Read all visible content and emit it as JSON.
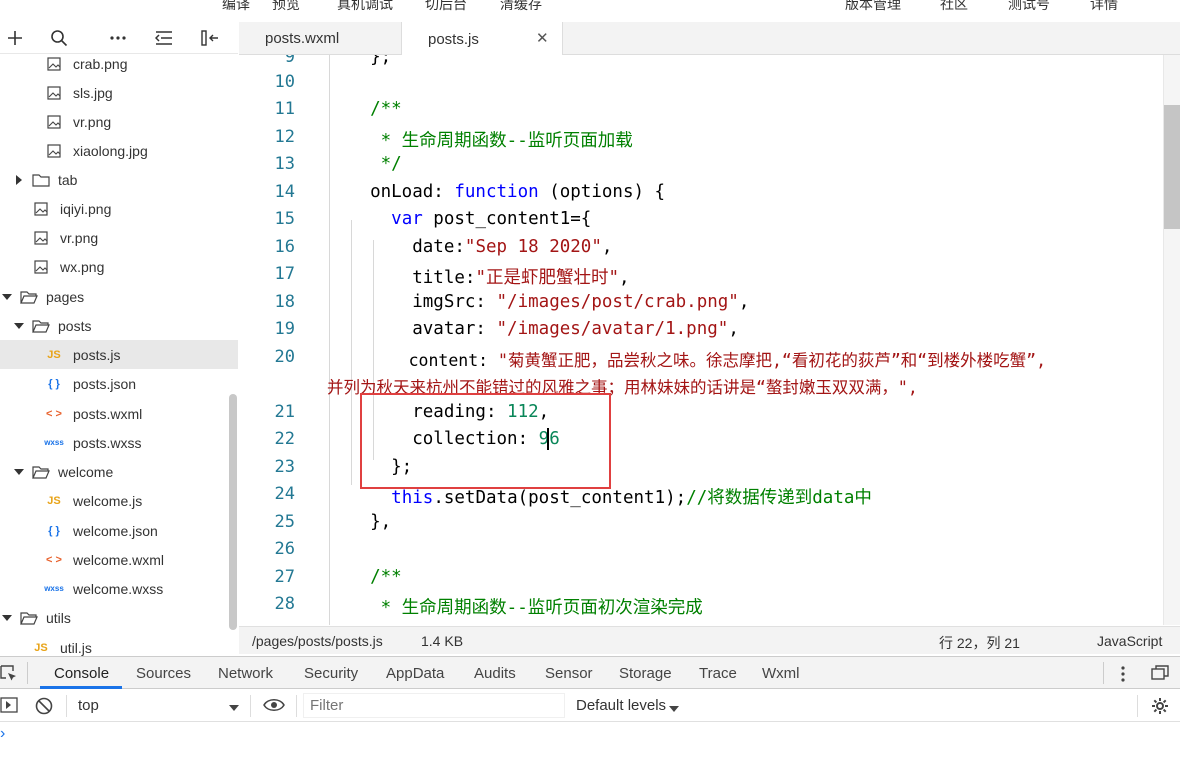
{
  "menu": [
    "编译",
    "预览",
    "真机调试",
    "切后台",
    "清缓存",
    "版本管理",
    "社区",
    "测试号",
    "详情"
  ],
  "explorer": {
    "items": [
      {
        "label": "crab.png",
        "type": "image"
      },
      {
        "label": "sls.jpg",
        "type": "image"
      },
      {
        "label": "vr.png",
        "type": "image"
      },
      {
        "label": "xiaolong.jpg",
        "type": "image"
      },
      {
        "label": "tab",
        "type": "folder",
        "expanded": false
      },
      {
        "label": "iqiyi.png",
        "type": "image"
      },
      {
        "label": "vr.png",
        "type": "image"
      },
      {
        "label": "wx.png",
        "type": "image"
      },
      {
        "label": "pages",
        "type": "folder",
        "expanded": true
      },
      {
        "label": "posts",
        "type": "folder",
        "expanded": true
      },
      {
        "label": "posts.js",
        "type": "js",
        "selected": true
      },
      {
        "label": "posts.json",
        "type": "json"
      },
      {
        "label": "posts.wxml",
        "type": "wxml"
      },
      {
        "label": "posts.wxss",
        "type": "wxss"
      },
      {
        "label": "welcome",
        "type": "folder",
        "expanded": true
      },
      {
        "label": "welcome.js",
        "type": "js"
      },
      {
        "label": "welcome.json",
        "type": "json"
      },
      {
        "label": "welcome.wxml",
        "type": "wxml"
      },
      {
        "label": "welcome.wxss",
        "type": "wxss"
      },
      {
        "label": "utils",
        "type": "folder",
        "expanded": true
      },
      {
        "label": "util.js",
        "type": "js"
      }
    ],
    "icon_text": {
      "js": "JS",
      "json": "{ }",
      "wxml": "< >",
      "wxss": "wxss"
    }
  },
  "tabs": [
    {
      "label": "posts.wxml",
      "active": false
    },
    {
      "label": "posts.js",
      "active": true,
      "close": "✕"
    }
  ],
  "editor": {
    "lines": [
      {
        "n": "9",
        "text": "  };"
      },
      {
        "n": "10",
        "text": ""
      },
      {
        "n": "11",
        "text": "  /**"
      },
      {
        "n": "12",
        "text": "   * 生命周期函数--监听页面加载"
      },
      {
        "n": "13",
        "text": "   */"
      },
      {
        "n": "14",
        "text": "  onLoad: function (options) {"
      },
      {
        "n": "15",
        "text": "    var post_content1={"
      },
      {
        "n": "16",
        "text": "      date:\"Sep 18 2020\","
      },
      {
        "n": "17",
        "text": "      title:\"正是虾肥蟹壮时\","
      },
      {
        "n": "18",
        "text": "      imgSrc: \"/images/post/crab.png\","
      },
      {
        "n": "19",
        "text": "      avatar: \"/images/avatar/1.png\","
      },
      {
        "n": "20",
        "text": "      content: \"菊黄蟹正肥，品尝秋之味。徐志摩把,“看初花的荻芦”和“到楼外楼吃蟹”,"
      },
      {
        "n": "",
        "text": "并列为秋天来杭州不能错过的风雅之事；用林妹妹的话讲是“螯封嫩玉双双满，\","
      },
      {
        "n": "21",
        "text": "      reading: 112,"
      },
      {
        "n": "22",
        "text": "      collection: 96"
      },
      {
        "n": "23",
        "text": "    };"
      },
      {
        "n": "24",
        "text": "    this.setData(post_content1);//将数据传递到data中"
      },
      {
        "n": "25",
        "text": "  },"
      },
      {
        "n": "26",
        "text": ""
      },
      {
        "n": "27",
        "text": "  /**"
      },
      {
        "n": "28",
        "text": "   * 生命周期函数--监听页面初次渲染完成"
      }
    ]
  },
  "status": {
    "path": "/pages/posts/posts.js",
    "size": "1.4 KB",
    "position": "行 22，列 21",
    "language": "JavaScript"
  },
  "devtools": {
    "tabs": [
      "Console",
      "Sources",
      "Network",
      "Security",
      "AppData",
      "Audits",
      "Sensor",
      "Storage",
      "Trace",
      "Wxml"
    ],
    "active_tab": "Console",
    "context": "top",
    "filter_placeholder": "Filter",
    "levels": "Default levels",
    "prompt": "›"
  },
  "colors": {
    "accent": "#1a73e8",
    "highlight_box": "#e04040",
    "selected_row": "#e8e8e8"
  }
}
